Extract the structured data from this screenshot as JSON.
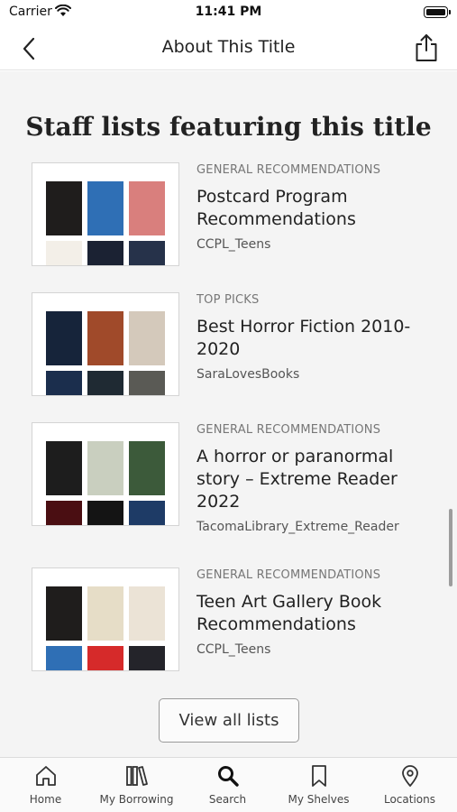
{
  "status_bar": {
    "carrier": "Carrier",
    "time": "11:41 PM"
  },
  "nav": {
    "title": "About This Title",
    "back_icon": "chevron-left-icon",
    "share_icon": "share-icon"
  },
  "section_title": "Staff lists featuring this title",
  "lists": [
    {
      "category": "GENERAL RECOMMENDATIONS",
      "title": "Postcard Program Recommendations",
      "owner": "CCPL_Teens",
      "covers": [
        "#1f1d1c",
        "#2f6fb5",
        "#d97f7d",
        "#f3efe8",
        "#1b2233",
        "#26324a"
      ]
    },
    {
      "category": "TOP PICKS",
      "title": "Best Horror Fiction 2010-2020",
      "owner": "SaraLovesBooks",
      "covers": [
        "#16243a",
        "#a04a2a",
        "#d4c9bb",
        "#1b2e4d",
        "#1f2a33",
        "#5a5a55"
      ]
    },
    {
      "category": "GENERAL RECOMMENDATIONS",
      "title": "A horror or paranormal story – Extreme Reader 2022",
      "owner": "TacomaLibrary_Extreme_Reader",
      "covers": [
        "#1d1d1d",
        "#c9cfbf",
        "#3c5a3a",
        "#4a0e12",
        "#141414",
        "#1e3b66"
      ]
    },
    {
      "category": "GENERAL RECOMMENDATIONS",
      "title": "Teen Art Gallery Book Recommendations",
      "owner": "CCPL_Teens",
      "covers": [
        "#1f1d1c",
        "#e6ddc7",
        "#ebe3d6",
        "#2f6fb5",
        "#d62a2a",
        "#24242a"
      ]
    }
  ],
  "view_all_label": "View all lists",
  "tabs": [
    {
      "label": "Home",
      "icon": "home-icon"
    },
    {
      "label": "My Borrowing",
      "icon": "books-icon"
    },
    {
      "label": "Search",
      "icon": "search-icon"
    },
    {
      "label": "My Shelves",
      "icon": "bookmark-icon"
    },
    {
      "label": "Locations",
      "icon": "location-pin-icon"
    }
  ]
}
